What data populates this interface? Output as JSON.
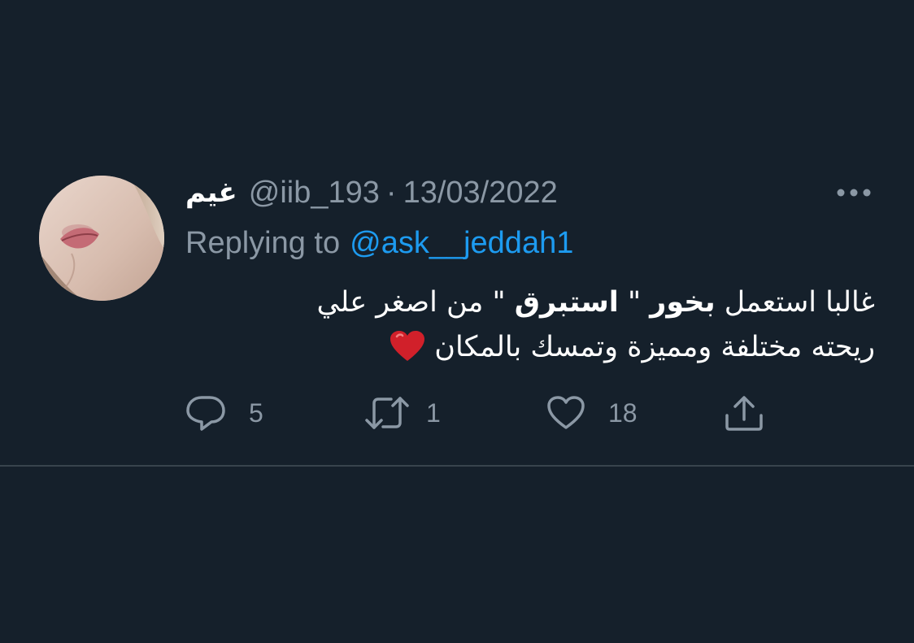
{
  "tweet": {
    "author": {
      "display_name": "غيم",
      "handle": "@iib_193"
    },
    "separator": "·",
    "date": "13/03/2022",
    "replying_to_label": "Replying to",
    "replying_to_handle": "@ask__jeddah1",
    "text": {
      "line1_part1": "غالبا استعمل ",
      "line1_bold1": "بخور",
      "line1_part2": " \" ",
      "line1_bold2": "استبرق",
      "line1_part3": " \" من اصغر علي",
      "line2": "ريحته مختلفة ومميزة وتمسك بالمكان"
    },
    "emoji": "red-heart",
    "actions": {
      "reply_count": "5",
      "retweet_count": "1",
      "like_count": "18"
    }
  },
  "colors": {
    "background": "#15202b",
    "text_primary": "#ffffff",
    "text_secondary": "#8b98a5",
    "link": "#1d9bf0",
    "divider": "#38444d",
    "heart": "#d1202a"
  },
  "icons": [
    "more-icon",
    "reply-icon",
    "retweet-icon",
    "like-icon",
    "share-icon"
  ]
}
